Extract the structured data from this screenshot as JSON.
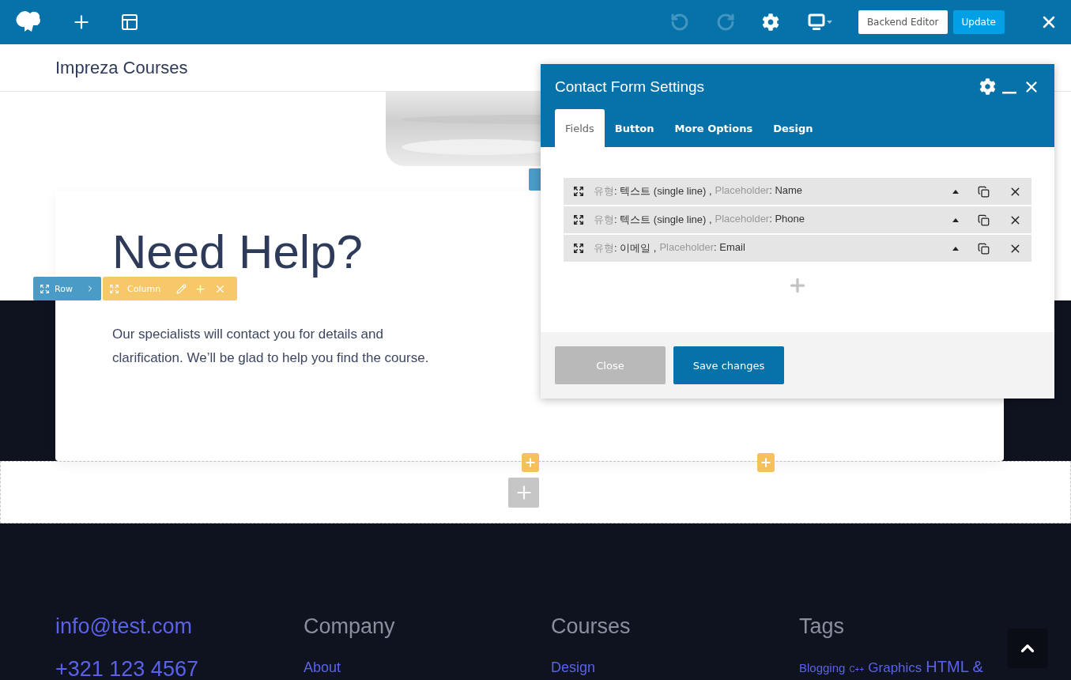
{
  "topbar": {
    "history": [
      {
        "kind": "undo",
        "disabled": true
      },
      {
        "kind": "redo",
        "disabled": true
      }
    ],
    "buttons": [
      {
        "label": "Backend Editor",
        "kind": "secondary"
      },
      {
        "label": "Update",
        "kind": "primary"
      }
    ]
  },
  "site_header": {
    "logo": "Impreza Courses"
  },
  "hero": {
    "title": "Need Help?",
    "text": "Our specialists will contact you for details and clarification. We’ll be glad to help you find the course."
  },
  "row_toolbar": {
    "row_label": "Row",
    "column_label": "Column"
  },
  "dialog": {
    "title": "Contact Form Settings",
    "tabs": [
      {
        "label": "Fields",
        "selected": true
      },
      {
        "label": "Button",
        "selected": false
      },
      {
        "label": "More Options",
        "selected": false
      },
      {
        "label": "Design",
        "selected": false
      }
    ],
    "fields": [
      {
        "type_label": "유형",
        "type": ": 텍스트 (single line) ,",
        "placeholder_label": "Placeholder",
        "placeholder": ": Name"
      },
      {
        "type_label": "유형",
        "type": ": 텍스트 (single line) ,",
        "placeholder_label": "Placeholder",
        "placeholder": ": Phone"
      },
      {
        "type_label": "유형",
        "type": ": 이메일 ,",
        "placeholder_label": "Placeholder",
        "placeholder": ": Email"
      }
    ],
    "buttons": [
      {
        "label": "Close",
        "kind": "secondary"
      },
      {
        "label": "Save changes",
        "kind": "primary"
      }
    ]
  },
  "footer": {
    "contacts": [
      "info@test.com",
      "+321 123 4567"
    ],
    "columns": [
      {
        "title": "Company",
        "links": [
          "About"
        ]
      },
      {
        "title": "Courses",
        "links": [
          "Design"
        ]
      }
    ],
    "tags_title": "Tags",
    "tags": [
      {
        "label": "Blogging",
        "kind": "small"
      },
      {
        "label": "C++",
        "kind": "tiny"
      },
      {
        "label": "Graphics",
        "kind": "medium"
      },
      {
        "label": "HTML &",
        "kind": "large"
      }
    ]
  }
}
